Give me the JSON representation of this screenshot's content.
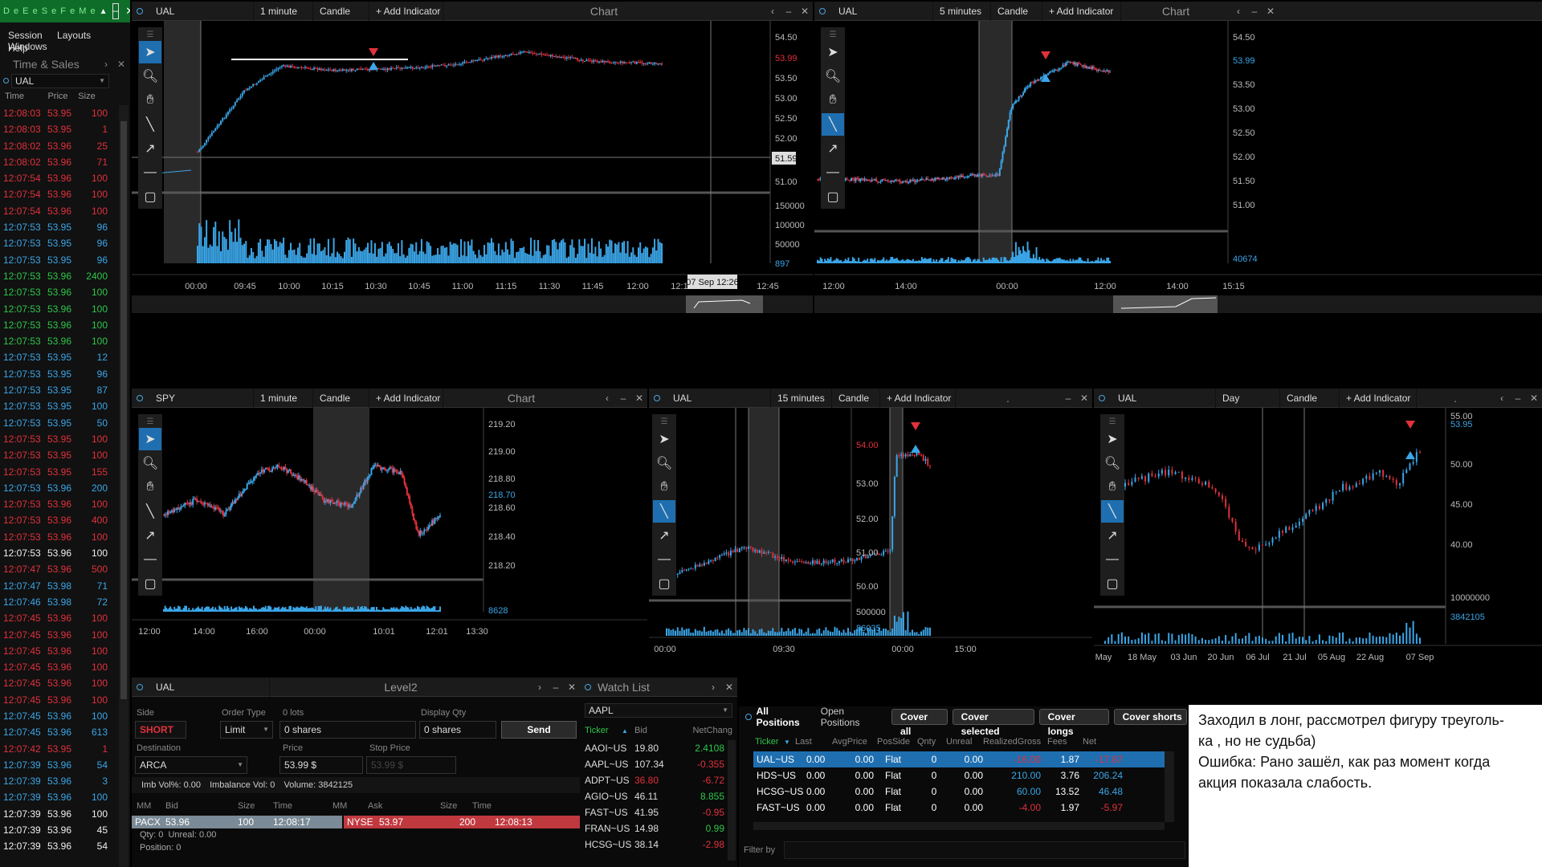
{
  "app": {
    "logo_letters": "D e E e S e F e M e",
    "menu": [
      "Session",
      "Layouts",
      "Windows",
      "Help"
    ]
  },
  "time_sales": {
    "title": "Time & Sales",
    "ticker": "UAL",
    "columns": [
      "Time",
      "Price",
      "Size"
    ],
    "rows": [
      {
        "t": "12:08:03",
        "p": "53.95",
        "s": "100",
        "c": "red"
      },
      {
        "t": "12:08:03",
        "p": "53.95",
        "s": "1",
        "c": "red"
      },
      {
        "t": "12:08:02",
        "p": "53.96",
        "s": "25",
        "c": "red"
      },
      {
        "t": "12:08:02",
        "p": "53.96",
        "s": "71",
        "c": "red"
      },
      {
        "t": "12:07:54",
        "p": "53.96",
        "s": "100",
        "c": "red"
      },
      {
        "t": "12:07:54",
        "p": "53.96",
        "s": "100",
        "c": "red"
      },
      {
        "t": "12:07:54",
        "p": "53.96",
        "s": "100",
        "c": "red"
      },
      {
        "t": "12:07:53",
        "p": "53.95",
        "s": "96",
        "c": "blue"
      },
      {
        "t": "12:07:53",
        "p": "53.95",
        "s": "96",
        "c": "blue"
      },
      {
        "t": "12:07:53",
        "p": "53.95",
        "s": "96",
        "c": "blue"
      },
      {
        "t": "12:07:53",
        "p": "53.96",
        "s": "2400",
        "c": "green"
      },
      {
        "t": "12:07:53",
        "p": "53.96",
        "s": "100",
        "c": "green"
      },
      {
        "t": "12:07:53",
        "p": "53.96",
        "s": "100",
        "c": "green"
      },
      {
        "t": "12:07:53",
        "p": "53.96",
        "s": "100",
        "c": "green"
      },
      {
        "t": "12:07:53",
        "p": "53.96",
        "s": "100",
        "c": "green"
      },
      {
        "t": "12:07:53",
        "p": "53.95",
        "s": "12",
        "c": "blue"
      },
      {
        "t": "12:07:53",
        "p": "53.95",
        "s": "96",
        "c": "blue"
      },
      {
        "t": "12:07:53",
        "p": "53.95",
        "s": "87",
        "c": "blue"
      },
      {
        "t": "12:07:53",
        "p": "53.95",
        "s": "100",
        "c": "blue"
      },
      {
        "t": "12:07:53",
        "p": "53.95",
        "s": "50",
        "c": "blue"
      },
      {
        "t": "12:07:53",
        "p": "53.95",
        "s": "100",
        "c": "red"
      },
      {
        "t": "12:07:53",
        "p": "53.95",
        "s": "100",
        "c": "red"
      },
      {
        "t": "12:07:53",
        "p": "53.95",
        "s": "155",
        "c": "red"
      },
      {
        "t": "12:07:53",
        "p": "53.96",
        "s": "200",
        "c": "blue"
      },
      {
        "t": "12:07:53",
        "p": "53.96",
        "s": "100",
        "c": "red"
      },
      {
        "t": "12:07:53",
        "p": "53.96",
        "s": "400",
        "c": "red"
      },
      {
        "t": "12:07:53",
        "p": "53.96",
        "s": "100",
        "c": "red"
      },
      {
        "t": "12:07:53",
        "p": "53.96",
        "s": "100",
        "c": "white"
      },
      {
        "t": "12:07:47",
        "p": "53.96",
        "s": "500",
        "c": "red"
      },
      {
        "t": "12:07:47",
        "p": "53.98",
        "s": "71",
        "c": "blue"
      },
      {
        "t": "12:07:46",
        "p": "53.98",
        "s": "72",
        "c": "blue"
      },
      {
        "t": "12:07:45",
        "p": "53.96",
        "s": "100",
        "c": "red"
      },
      {
        "t": "12:07:45",
        "p": "53.96",
        "s": "100",
        "c": "red"
      },
      {
        "t": "12:07:45",
        "p": "53.96",
        "s": "100",
        "c": "red"
      },
      {
        "t": "12:07:45",
        "p": "53.96",
        "s": "100",
        "c": "red"
      },
      {
        "t": "12:07:45",
        "p": "53.96",
        "s": "100",
        "c": "red"
      },
      {
        "t": "12:07:45",
        "p": "53.96",
        "s": "100",
        "c": "red"
      },
      {
        "t": "12:07:45",
        "p": "53.96",
        "s": "100",
        "c": "blue"
      },
      {
        "t": "12:07:45",
        "p": "53.96",
        "s": "613",
        "c": "blue"
      },
      {
        "t": "12:07:42",
        "p": "53.95",
        "s": "1",
        "c": "red"
      },
      {
        "t": "12:07:39",
        "p": "53.96",
        "s": "54",
        "c": "blue"
      },
      {
        "t": "12:07:39",
        "p": "53.96",
        "s": "3",
        "c": "blue"
      },
      {
        "t": "12:07:39",
        "p": "53.96",
        "s": "100",
        "c": "blue"
      },
      {
        "t": "12:07:39",
        "p": "53.96",
        "s": "100",
        "c": "white"
      },
      {
        "t": "12:07:39",
        "p": "53.96",
        "s": "45",
        "c": "white"
      },
      {
        "t": "12:07:39",
        "p": "53.96",
        "s": "54",
        "c": "white"
      }
    ]
  },
  "charts": {
    "c1": {
      "ticker": "UAL",
      "interval": "1 minute",
      "type": "Candle",
      "add": "+ Add Indicator",
      "title": "Chart",
      "y_labels": [
        "54.50",
        "53.99",
        "53.50",
        "53.00",
        "52.50",
        "52.00",
        "51.59",
        "51.00",
        "150000",
        "100000",
        "50000",
        "897"
      ],
      "x_labels": [
        "00:00",
        "09:45",
        "10:00",
        "10:15",
        "10:30",
        "10:45",
        "11:00",
        "11:15",
        "11:30",
        "11:45",
        "12:00",
        "12:1",
        "12:45"
      ],
      "crosshair_label": "07 Sep 12:26"
    },
    "c2": {
      "ticker": "UAL",
      "interval": "5 minutes",
      "type": "Candle",
      "add": "+ Add Indicator",
      "title": "Chart",
      "y_labels": [
        "54.50",
        "53.99",
        "53.50",
        "53.00",
        "52.50",
        "52.00",
        "51.50",
        "51.00",
        "40674"
      ],
      "x_labels": [
        "12:00",
        "14:00",
        "00:00",
        "12:00",
        "14:00",
        "15:15"
      ]
    },
    "c3": {
      "ticker": "SPY",
      "interval": "1 minute",
      "type": "Candle",
      "add": "+ Add Indicator",
      "title": "Chart",
      "y_labels": [
        "219.20",
        "219.00",
        "218.80",
        "218.70",
        "218.60",
        "218.40",
        "218.20",
        "8628"
      ],
      "x_labels": [
        "12:00",
        "14:00",
        "16:00",
        "00:00",
        "10:01",
        "12:01",
        "13:30"
      ]
    },
    "c4": {
      "ticker": "UAL",
      "interval": "15 minutes",
      "type": "Candle",
      "add": "+ Add Indicator",
      "title": ".",
      "y_labels": [
        "54.00",
        "53.00",
        "52.00",
        "51.00",
        "50.00",
        "500000",
        "86035"
      ],
      "x_labels": [
        "00:00",
        "09:30",
        "00:00",
        "15:00"
      ]
    },
    "c5": {
      "ticker": "UAL",
      "interval": "Day",
      "type": "Candle",
      "add": "+ Add Indicator",
      "title": ".",
      "y_labels": [
        "55.00",
        "53.95",
        "50.00",
        "45.00",
        "40.00",
        "10000000",
        "3842105"
      ],
      "x_labels": [
        "May",
        "18 May",
        "03 Jun",
        "20 Jun",
        "06 Jul",
        "21 Jul",
        "05 Aug",
        "22 Aug",
        "07 Sep"
      ]
    }
  },
  "level2": {
    "ticker": "UAL",
    "title": "Level2",
    "side_label": "Side",
    "side": "SHORT",
    "order_type_label": "Order Type",
    "order_type": "Limit",
    "lots_label": "0 lots",
    "shares": "0 shares",
    "display_qty_label": "Display Qty",
    "display_qty": "0 shares",
    "send": "Send",
    "destination_label": "Destination",
    "destination": "ARCA",
    "price_label": "Price",
    "price": "53.99 $",
    "stop_label": "Stop Price",
    "stop_price": "53.99 $",
    "imb_vol": "Imb Vol%: 0.00",
    "imbalance": "Imbalance Vol: 0",
    "volume": "Volume: 3842125",
    "cols": [
      "MM",
      "Bid",
      "Size",
      "Time",
      "MM",
      "Ask",
      "Size",
      "Time"
    ],
    "bid": {
      "mm": "PACX",
      "price": "53.96",
      "size": "100",
      "time": "12:08:17"
    },
    "ask": {
      "mm": "NYSE",
      "price": "53.97",
      "size": "200",
      "time": "12:08:13"
    },
    "qty": "Qty: 0",
    "unreal": "Unreal: 0.00",
    "position": "Position: 0"
  },
  "watchlist": {
    "title": "Watch List",
    "ticker": "AAPL",
    "cols": [
      "Ticker",
      "Bid",
      "NetChang"
    ],
    "rows": [
      {
        "t": "AAOI~US",
        "b": "19.80",
        "n": "2.4108",
        "c": "green"
      },
      {
        "t": "AAPL~US",
        "b": "107.34",
        "n": "-0.355",
        "c": "red"
      },
      {
        "t": "ADPT~US",
        "b": "36.80",
        "n": "-6.72",
        "c": "red",
        "bc": "red"
      },
      {
        "t": "AGIO~US",
        "b": "46.11",
        "n": "8.855",
        "c": "green"
      },
      {
        "t": "FAST~US",
        "b": "41.95",
        "n": "-0.95",
        "c": "red"
      },
      {
        "t": "FRAN~US",
        "b": "14.98",
        "n": "0.99",
        "c": "green"
      },
      {
        "t": "HCSG~US",
        "b": "38.14",
        "n": "-2.98",
        "c": "red"
      }
    ]
  },
  "positions": {
    "tab_all": "All Positions",
    "tab_open": "Open Positions",
    "buttons": [
      "Cover all",
      "Cover selected",
      "Cover longs",
      "Cover shorts"
    ],
    "cols": [
      "Ticker",
      "Last",
      "AvgPrice",
      "PosSide",
      "Qnty",
      "Unreal",
      "RealizedGross",
      "Fees",
      "Net"
    ],
    "rows": [
      {
        "t": "UAL~US",
        "l": "0.00",
        "a": "0.00",
        "ps": "Flat",
        "q": "0",
        "u": "0.00",
        "rg": "-16.00",
        "f": "1.87",
        "n": "-17.87",
        "rc": "red",
        "nc": "red",
        "sel": true
      },
      {
        "t": "HDS~US",
        "l": "0.00",
        "a": "0.00",
        "ps": "Flat",
        "q": "0",
        "u": "0.00",
        "rg": "210.00",
        "f": "3.76",
        "n": "206.24",
        "rc": "blue",
        "nc": "blue"
      },
      {
        "t": "HCSG~US",
        "l": "0.00",
        "a": "0.00",
        "ps": "Flat",
        "q": "0",
        "u": "0.00",
        "rg": "60.00",
        "f": "13.52",
        "n": "46.48",
        "rc": "blue",
        "nc": "blue"
      },
      {
        "t": "FAST~US",
        "l": "0.00",
        "a": "0.00",
        "ps": "Flat",
        "q": "0",
        "u": "0.00",
        "rg": "-4.00",
        "f": "1.97",
        "n": "-5.97",
        "rc": "red",
        "nc": "red"
      }
    ],
    "filter": "Filter by"
  },
  "note": {
    "line1": "Заходил в лонг,  рассмотрел фигуру треуголь-",
    "line2": "ка , но не судьба)",
    "line3": "Ошибка: Рано зашёл, как раз момент когда",
    "line4": "акция показала слабость."
  },
  "colors": {
    "up": "#3ba6e8",
    "down": "#e0313c",
    "accent": "#1f6fb0"
  }
}
